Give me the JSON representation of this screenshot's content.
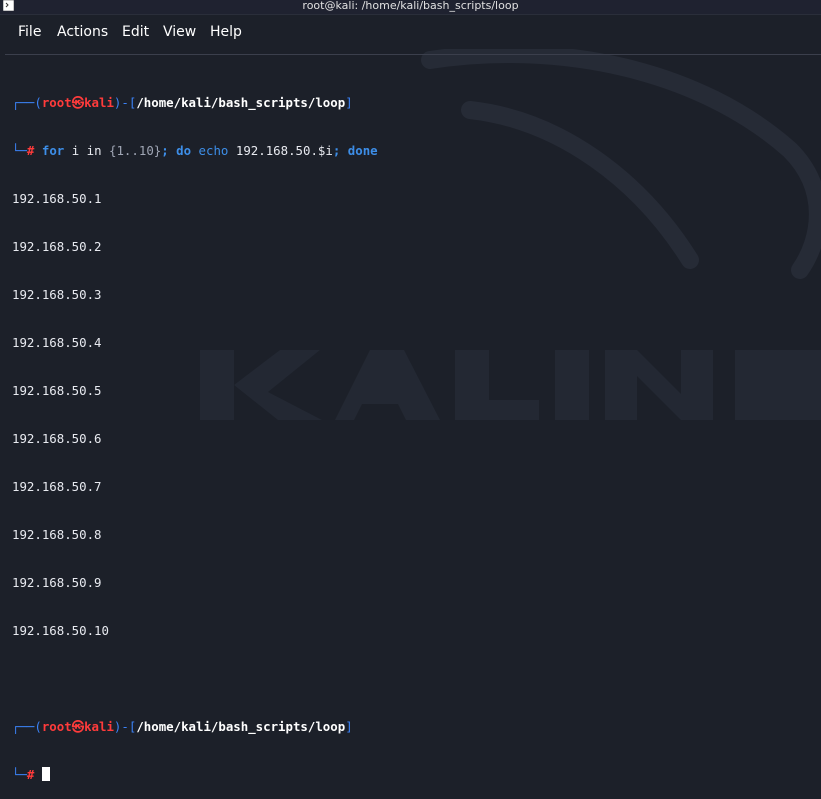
{
  "window": {
    "title": "root@kali: /home/kali/bash_scripts/loop"
  },
  "menu": {
    "file": "File",
    "actions": "Actions",
    "edit": "Edit",
    "view": "View",
    "help": "Help"
  },
  "prompt1": {
    "top_left": "┌──(",
    "user": "root",
    "at_symbol": "㉿",
    "host": "kali",
    "mid": ")-[",
    "path": "/home/kali/bash_scripts/loop",
    "close": "]",
    "bottom_left": "└─",
    "hash": "#",
    "cmd_for": "for",
    "cmd_i_in": " i in ",
    "cmd_range": "{1..10}",
    "cmd_semi1": ";",
    "cmd_do": " do",
    "cmd_echo": " echo",
    "cmd_arg": " 192.168.50.$i",
    "cmd_semi2": ";",
    "cmd_done": " done"
  },
  "output": [
    "192.168.50.1",
    "192.168.50.2",
    "192.168.50.3",
    "192.168.50.4",
    "192.168.50.5",
    "192.168.50.6",
    "192.168.50.7",
    "192.168.50.8",
    "192.168.50.9",
    "192.168.50.10"
  ],
  "prompt2": {
    "top_left": "┌──(",
    "user": "root",
    "at_symbol": "㉿",
    "host": "kali",
    "mid": ")-[",
    "path": "/home/kali/bash_scripts/loop",
    "close": "]",
    "bottom_left": "└─",
    "hash": "#"
  },
  "colors": {
    "background": "#1c2029",
    "prompt_frame": "#3b82f6",
    "prompt_user": "#ff3b3b",
    "keyword": "#3d8ee8"
  },
  "watermark_icon": "kali-dragon-logo"
}
